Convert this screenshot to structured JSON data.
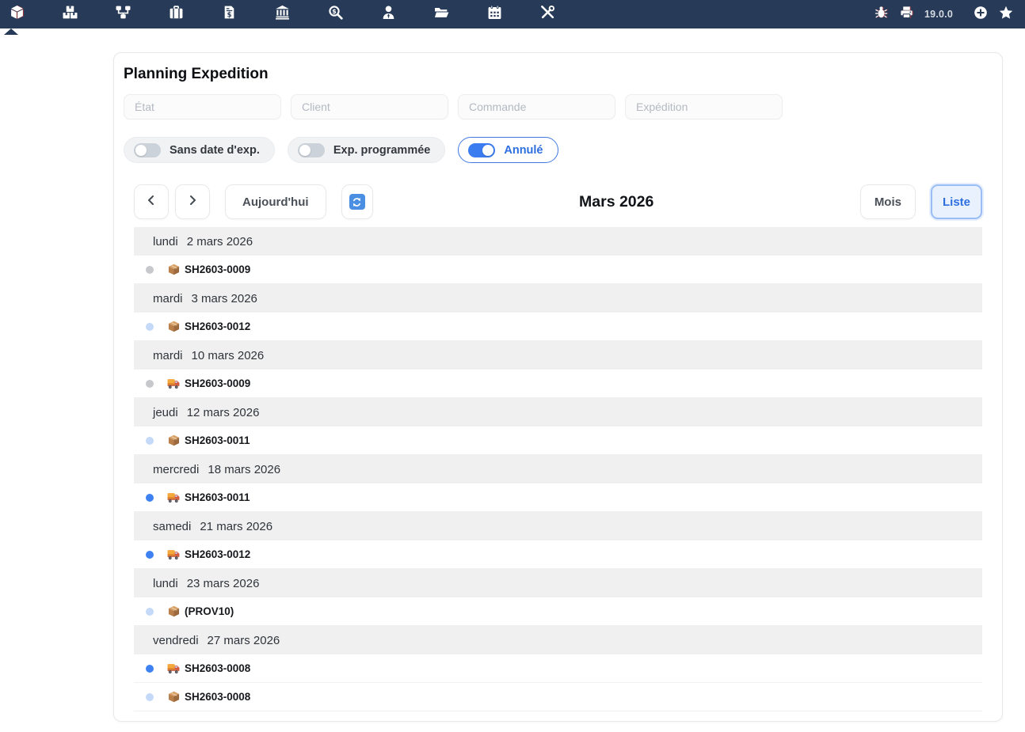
{
  "navbar": {
    "version": "19.0.0",
    "menu_icons": [
      "cube",
      "boxes",
      "diagram",
      "briefcase",
      "invoice-dollar",
      "bank",
      "search-dollar",
      "user-tie",
      "folder-open",
      "calendar",
      "tools"
    ],
    "right_icons": [
      "bug",
      "printer",
      "plus-circle",
      "star"
    ]
  },
  "panel": {
    "title": "Planning Expedition",
    "filters": [
      {
        "placeholder": "État",
        "value": ""
      },
      {
        "placeholder": "Client",
        "value": ""
      },
      {
        "placeholder": "Commande",
        "value": ""
      },
      {
        "placeholder": "Expédition",
        "value": ""
      }
    ],
    "toggles": [
      {
        "label": "Sans date d'exp.",
        "on": false
      },
      {
        "label": "Exp. programmée",
        "on": false
      },
      {
        "label": "Annulé",
        "on": true
      }
    ]
  },
  "calendar": {
    "today_label": "Aujourd'hui",
    "title": "Mars 2026",
    "month_label": "Mois",
    "list_label": "Liste",
    "rows": [
      {
        "type": "day",
        "weekday": "lundi",
        "date": "2 mars 2026"
      },
      {
        "type": "event",
        "dot": "gray",
        "icon": "package",
        "label": "SH2603-0009"
      },
      {
        "type": "day",
        "weekday": "mardi",
        "date": "3 mars 2026"
      },
      {
        "type": "event",
        "dot": "light_blue",
        "icon": "package",
        "label": "SH2603-0012"
      },
      {
        "type": "day",
        "weekday": "mardi",
        "date": "10 mars 2026"
      },
      {
        "type": "event",
        "dot": "gray",
        "icon": "truck",
        "label": "SH2603-0009"
      },
      {
        "type": "day",
        "weekday": "jeudi",
        "date": "12 mars 2026"
      },
      {
        "type": "event",
        "dot": "light_blue",
        "icon": "package",
        "label": "SH2603-0011"
      },
      {
        "type": "day",
        "weekday": "mercredi",
        "date": "18 mars 2026"
      },
      {
        "type": "event",
        "dot": "blue",
        "icon": "truck",
        "label": "SH2603-0011"
      },
      {
        "type": "day",
        "weekday": "samedi",
        "date": "21 mars 2026"
      },
      {
        "type": "event",
        "dot": "blue",
        "icon": "truck",
        "label": "SH2603-0012"
      },
      {
        "type": "day",
        "weekday": "lundi",
        "date": "23 mars 2026"
      },
      {
        "type": "event",
        "dot": "light_blue",
        "icon": "package",
        "label": "(PROV10)"
      },
      {
        "type": "day",
        "weekday": "vendredi",
        "date": "27 mars 2026"
      },
      {
        "type": "event",
        "dot": "blue",
        "icon": "truck",
        "label": "SH2603-0008"
      },
      {
        "type": "event",
        "dot": "light_blue",
        "icon": "package",
        "label": "SH2603-0008"
      }
    ]
  },
  "colors": {
    "navbar_bg": "#273a57",
    "accent_blue": "#2e6fe0",
    "dot_gray": "#c6c8cc",
    "dot_light_blue": "#c5d9f8",
    "dot_blue": "#3e82f2",
    "day_row_bg": "#f0f0f0"
  }
}
